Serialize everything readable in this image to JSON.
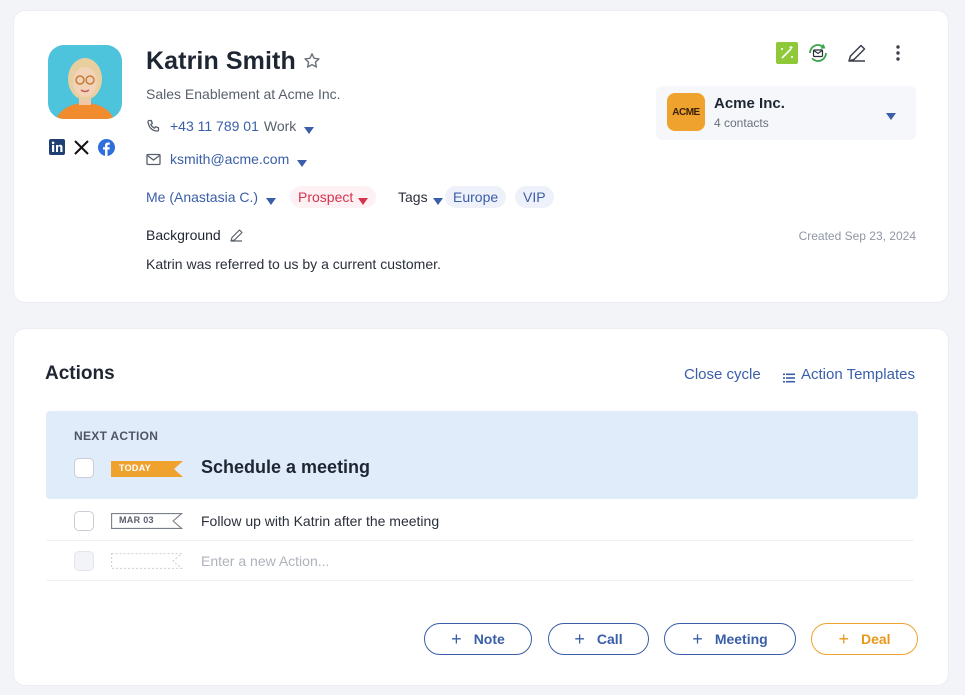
{
  "contact": {
    "name": "Katrin Smith",
    "job_title": "Sales Enablement at Acme Inc.",
    "phone": "+43 11 789 01",
    "phone_type": "Work",
    "email": "ksmith@acme.com",
    "owner": "Me (Anastasia C.)",
    "status": "Prospect",
    "tags_label": "Tags",
    "tags": [
      "Europe",
      "VIP"
    ],
    "background_label": "Background",
    "background_text": "Katrin was referred to us by a current customer.",
    "created": "Created Sep 23, 2024",
    "social": [
      "linkedin-icon",
      "x-icon",
      "facebook-icon"
    ]
  },
  "company": {
    "logo_text": "ACME",
    "name": "Acme Inc.",
    "contacts": "4 contacts"
  },
  "actions": {
    "title": "Actions",
    "close_cycle": "Close cycle",
    "templates": "Action Templates",
    "next_label": "NEXT ACTION",
    "next": {
      "flag": "TODAY",
      "title": "Schedule a meeting"
    },
    "items": [
      {
        "flag": "MAR 03",
        "title": "Follow up with Katrin after the meeting"
      }
    ],
    "new_placeholder": "Enter a new Action..."
  },
  "buttons": {
    "note": "Note",
    "call": "Call",
    "meeting": "Meeting",
    "deal": "Deal"
  },
  "colors": {
    "accent_blue": "#3a5ea8",
    "prospect_red": "#d6334f",
    "acme_orange": "#f0a22e",
    "next_action_bg": "#e1ecfb"
  }
}
